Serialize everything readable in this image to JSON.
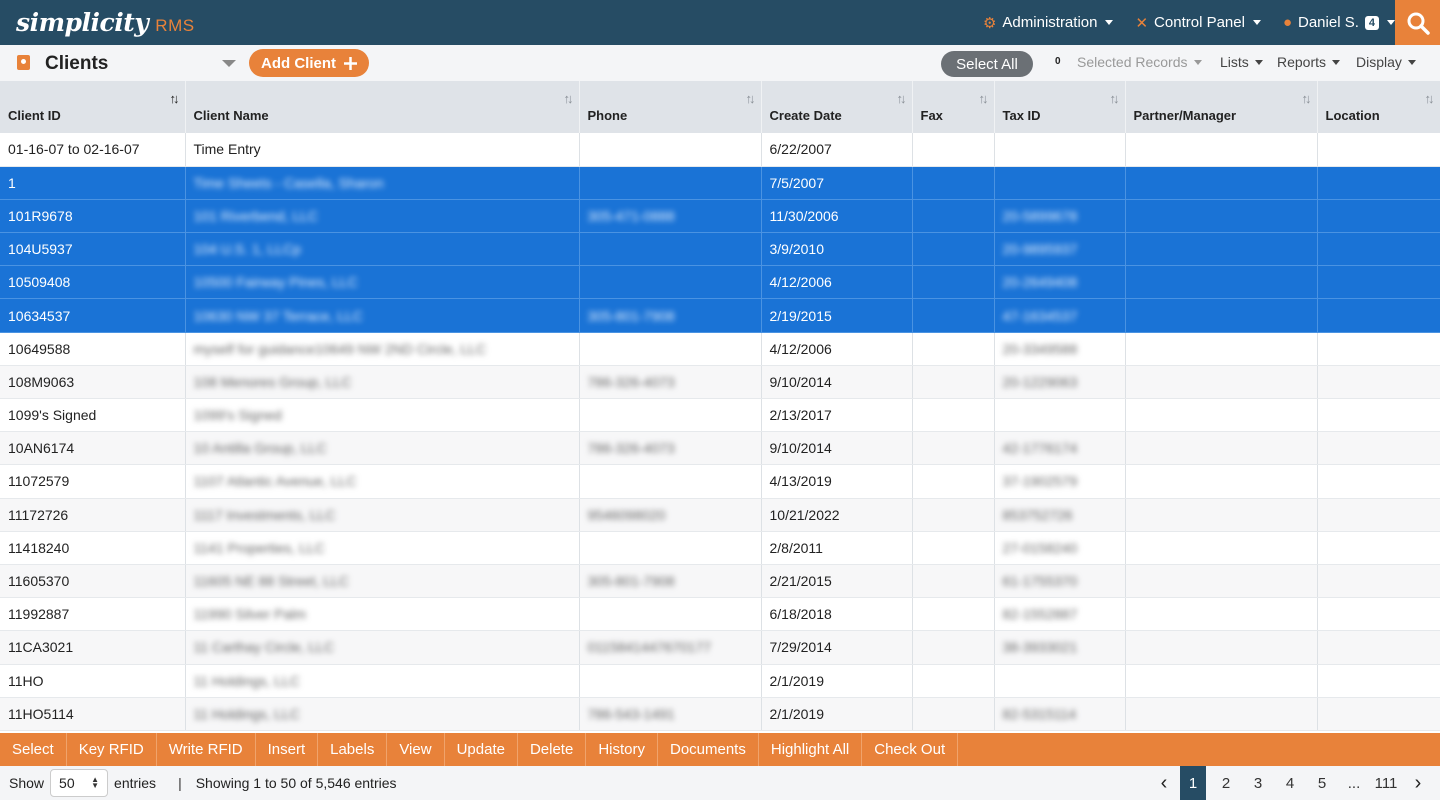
{
  "app": {
    "logo_main": "simplicity",
    "logo_sub": "RMS"
  },
  "topnav": {
    "administration": "Administration",
    "control_panel": "Control Panel",
    "user": "Daniel S.",
    "user_badge": "4"
  },
  "toolbar": {
    "title": "Clients",
    "add_client": "Add Client",
    "select_all": "Select All",
    "selected_count": "0",
    "selected_records": "Selected Records",
    "lists": "Lists",
    "reports": "Reports",
    "display": "Display"
  },
  "table": {
    "columns": [
      "Client ID",
      "Client Name",
      "Phone",
      "Create Date",
      "Fax",
      "Tax ID",
      "Partner/Manager",
      "Location"
    ],
    "rows": [
      {
        "id": "01-16-07 to 02-16-07",
        "name": "Time Entry",
        "phone": "",
        "date": "6/22/2007",
        "fax": "",
        "tax": "",
        "selected": false
      },
      {
        "id": "1",
        "name": "Time Sheets - Casella, Sharon",
        "phone": "",
        "date": "7/5/2007",
        "fax": "",
        "tax": "",
        "selected": true
      },
      {
        "id": "101R9678",
        "name": "101 Riverbend, LLC",
        "phone": "305-471-0888",
        "date": "11/30/2006",
        "fax": "",
        "tax": "20-5899678",
        "selected": true
      },
      {
        "id": "104U5937",
        "name": "104 U.S. 1, LLCp",
        "phone": "",
        "date": "3/9/2010",
        "fax": "",
        "tax": "20-9895937",
        "selected": true
      },
      {
        "id": "10509408",
        "name": "10500 Fairway Pines, LLC",
        "phone": "",
        "date": "4/12/2006",
        "fax": "",
        "tax": "20-2649408",
        "selected": true
      },
      {
        "id": "10634537",
        "name": "10630 NW 37 Terrace, LLC",
        "phone": "305-801-7908",
        "date": "2/19/2015",
        "fax": "",
        "tax": "47-1634537",
        "selected": true
      },
      {
        "id": "10649588",
        "name": "myself for guidance10649 NW 2ND Circle, LLC",
        "phone": "",
        "date": "4/12/2006",
        "fax": "",
        "tax": "20-3349588",
        "selected": false
      },
      {
        "id": "108M9063",
        "name": "108 Menores Group, LLC",
        "phone": "786-326-4073",
        "date": "9/10/2014",
        "fax": "",
        "tax": "20-1229063",
        "selected": false
      },
      {
        "id": "1099's Signed",
        "name": "1099's Signed",
        "phone": "",
        "date": "2/13/2017",
        "fax": "",
        "tax": "",
        "selected": false
      },
      {
        "id": "10AN6174",
        "name": "10 Antilla Group, LLC",
        "phone": "786-326-4073",
        "date": "9/10/2014",
        "fax": "",
        "tax": "42-1776174",
        "selected": false
      },
      {
        "id": "11072579",
        "name": "1107 Atlantic Avenue, LLC",
        "phone": "",
        "date": "4/13/2019",
        "fax": "",
        "tax": "37-1902579",
        "selected": false
      },
      {
        "id": "11172726",
        "name": "1117 Investments, LLC",
        "phone": "9546098020",
        "date": "10/21/2022",
        "fax": "",
        "tax": "853752726",
        "selected": false
      },
      {
        "id": "11418240",
        "name": "1141 Properties, LLC",
        "phone": "",
        "date": "2/8/2011",
        "fax": "",
        "tax": "27-0158240",
        "selected": false
      },
      {
        "id": "11605370",
        "name": "11605 NE 88 Street, LLC",
        "phone": "305-801-7908",
        "date": "2/21/2015",
        "fax": "",
        "tax": "61-1755370",
        "selected": false
      },
      {
        "id": "11992887",
        "name": "11990 Silver Palm",
        "phone": "",
        "date": "6/18/2018",
        "fax": "",
        "tax": "82-1552887",
        "selected": false
      },
      {
        "id": "11CA3021",
        "name": "11 Carthay Circle, LLC",
        "phone": "0115841447670177",
        "date": "7/29/2014",
        "fax": "",
        "tax": "38-3933021",
        "selected": false
      },
      {
        "id": "11HO",
        "name": "11 Holdings, LLC",
        "phone": "",
        "date": "2/1/2019",
        "fax": "",
        "tax": "",
        "selected": false
      },
      {
        "id": "11HO5114",
        "name": "11 Holdings, LLC",
        "phone": "786-543-1491",
        "date": "2/1/2019",
        "fax": "",
        "tax": "82-5315114",
        "selected": false
      }
    ]
  },
  "actions": [
    "Select",
    "Key RFID",
    "Write RFID",
    "Insert",
    "Labels",
    "View",
    "Update",
    "Delete",
    "History",
    "Documents",
    "Highlight All",
    "Check Out"
  ],
  "footer": {
    "show": "Show",
    "page_length": "50",
    "entries": "entries",
    "separator": "|",
    "info": "Showing 1 to 50 of 5,546 entries",
    "pages": [
      "1",
      "2",
      "3",
      "4",
      "5",
      "...",
      "111"
    ],
    "prev": "‹",
    "next": "›"
  }
}
